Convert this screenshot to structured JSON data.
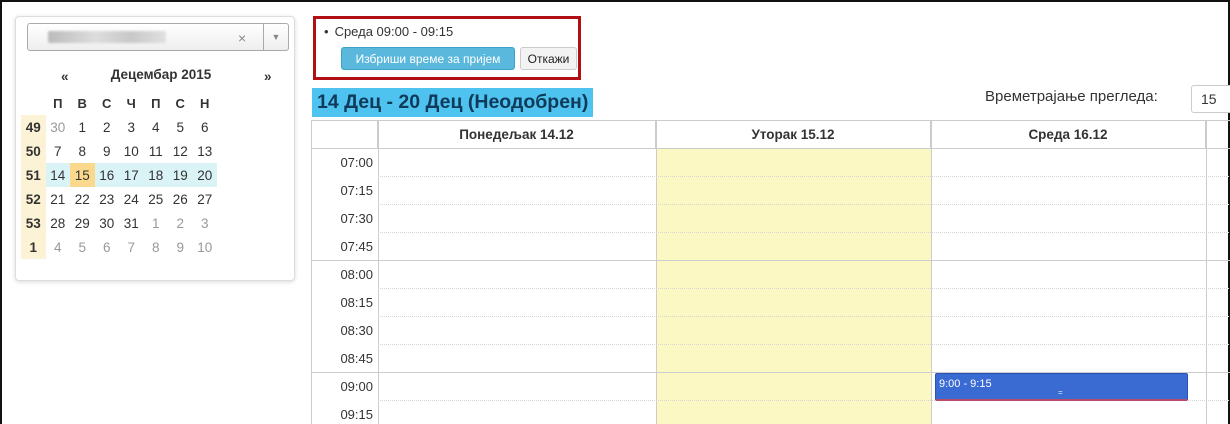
{
  "calendar": {
    "prev_label": "«",
    "next_label": "»",
    "month_title": "Децембар 2015",
    "weekday_headers": [
      "П",
      "В",
      "С",
      "Ч",
      "П",
      "С",
      "Н"
    ],
    "weeks": [
      {
        "week": "49",
        "days": [
          "30",
          "1",
          "2",
          "3",
          "4",
          "5",
          "6"
        ]
      },
      {
        "week": "50",
        "days": [
          "7",
          "8",
          "9",
          "10",
          "11",
          "12",
          "13"
        ]
      },
      {
        "week": "51",
        "days": [
          "14",
          "15",
          "16",
          "17",
          "18",
          "19",
          "20"
        ]
      },
      {
        "week": "52",
        "days": [
          "21",
          "22",
          "23",
          "24",
          "25",
          "26",
          "27"
        ]
      },
      {
        "week": "53",
        "days": [
          "28",
          "29",
          "30",
          "31",
          "1",
          "2",
          "3"
        ]
      },
      {
        "week": "1",
        "days": [
          "4",
          "5",
          "6",
          "7",
          "8",
          "9",
          "10"
        ]
      }
    ]
  },
  "select": {
    "clear_icon": "×",
    "arrow_icon": "▼"
  },
  "popup": {
    "slot_text": "Среда 09:00 - 09:15",
    "delete_label": "Избриши време за пријем",
    "cancel_label": "Откажи"
  },
  "schedule": {
    "week_title": "14 Дец - 20 Дец (Неодобрен)",
    "duration_label": "Времетрајање прегледа:",
    "duration_value": "15",
    "day_headers": [
      "Понедељак 14.12",
      "Уторак 15.12",
      "Среда 16.12"
    ],
    "times": [
      "07:00",
      "07:15",
      "07:30",
      "07:45",
      "08:00",
      "08:15",
      "08:30",
      "08:45",
      "09:00",
      "09:15"
    ],
    "event_label": "9:00 - 9:15",
    "event_grip": "=",
    "highlight_color": "#fcf8c3",
    "event_color": "#3a6bd3"
  }
}
